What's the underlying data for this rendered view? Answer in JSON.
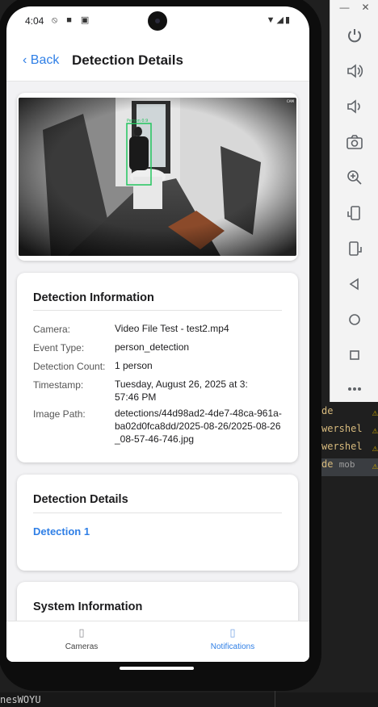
{
  "background": {
    "code_lines": [
      {
        "text": "de",
        "sub": ""
      },
      {
        "text": "wershel",
        "sub": ""
      },
      {
        "text": "wershel",
        "sub": ""
      },
      {
        "text": "de",
        "sub": "mob"
      }
    ],
    "bottom_text": "nesWOYU"
  },
  "status_bar": {
    "time": "4:04",
    "icons_left": "⦸ ■ ▣",
    "icons_right": "▼◢▮"
  },
  "header": {
    "back_label": "‹ Back",
    "title": "Detection Details"
  },
  "image": {
    "overlay_label": "Person 0.9",
    "corner_text": "CAM"
  },
  "detection_info": {
    "heading": "Detection Information",
    "rows": [
      {
        "label": "Camera:",
        "value": "Video File Test - test2.mp4"
      },
      {
        "label": "Event Type:",
        "value": "person_detection"
      },
      {
        "label": "Detection Count:",
        "value": "1 person"
      },
      {
        "label": "Timestamp:",
        "value": "Tuesday, August 26, 2025 at 3:57:46 PM"
      },
      {
        "label": "Image Path:",
        "value": "detections/44d98ad2-4de7-48ca-961a-ba02d0fca8dd/2025-08-26/2025-08-26_08-57-46-746.jpg"
      }
    ]
  },
  "detection_details": {
    "heading": "Detection Details",
    "items": [
      "Detection 1"
    ]
  },
  "system_info": {
    "heading": "System Information"
  },
  "tabs": [
    {
      "label": "Cameras",
      "icon": "camera-icon"
    },
    {
      "label": "Notifications",
      "icon": "bell-icon"
    }
  ],
  "colors": {
    "accent": "#2f7fe6",
    "detection_box": "#22c55e"
  }
}
